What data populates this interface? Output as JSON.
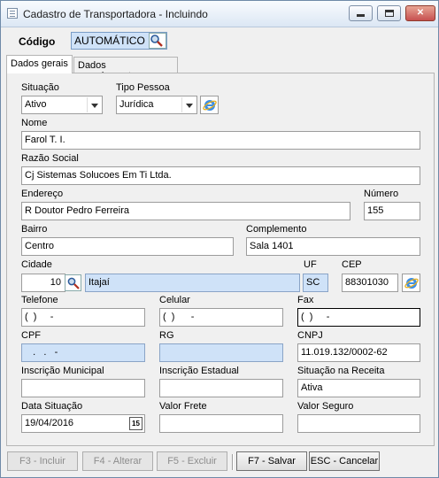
{
  "window": {
    "title": "Cadastro de Transportadora - Incluindo",
    "min_label": "",
    "max_label": "",
    "close_label": "✕"
  },
  "codigo": {
    "label": "Código",
    "value": "AUTOMÁTICO"
  },
  "tabs": [
    "Dados gerais",
    "Dados complementares"
  ],
  "form": {
    "situacao": {
      "label": "Situação",
      "value": "Ativo"
    },
    "tipo_pessoa": {
      "label": "Tipo Pessoa",
      "value": "Jurídica"
    },
    "nome": {
      "label": "Nome",
      "value": "Farol T. I."
    },
    "razao_social": {
      "label": "Razão Social",
      "value": "Cj Sistemas Solucoes Em Ti Ltda."
    },
    "endereco": {
      "label": "Endereço",
      "value": "R Doutor Pedro Ferreira"
    },
    "numero": {
      "label": "Número",
      "value": "155"
    },
    "bairro": {
      "label": "Bairro",
      "value": "Centro"
    },
    "complemento": {
      "label": "Complemento",
      "value": "Sala 1401"
    },
    "cidade": {
      "label": "Cidade",
      "code": "10",
      "name": "Itajaí"
    },
    "uf": {
      "label": "UF",
      "value": "SC"
    },
    "cep": {
      "label": "CEP",
      "value": "88301030"
    },
    "telefone": {
      "label": "Telefone",
      "value": "(  )     -"
    },
    "celular": {
      "label": "Celular",
      "value": "(  )      -"
    },
    "fax": {
      "label": "Fax",
      "value": "(  )     -"
    },
    "cpf": {
      "label": "CPF",
      "value": "   .   .   -"
    },
    "rg": {
      "label": "RG",
      "value": ""
    },
    "cnpj": {
      "label": "CNPJ",
      "value": "11.019.132/0002-62"
    },
    "inscricao_municipal": {
      "label": "Inscrição Municipal",
      "value": ""
    },
    "inscricao_estadual": {
      "label": "Inscrição Estadual",
      "value": ""
    },
    "situacao_receita": {
      "label": "Situação na Receita",
      "value": "Ativa"
    },
    "data_situacao": {
      "label": "Data Situação",
      "value": "19/04/2016",
      "cal_label": "15"
    },
    "valor_frete": {
      "label": "Valor Frete",
      "value": ""
    },
    "valor_seguro": {
      "label": "Valor Seguro",
      "value": ""
    }
  },
  "buttons": {
    "incluir": "F3 - Incluir",
    "alterar": "F4 - Alterar",
    "excluir": "F5 - Excluir",
    "salvar": "F7 - Salvar",
    "cancelar": "ESC - Cancelar"
  }
}
